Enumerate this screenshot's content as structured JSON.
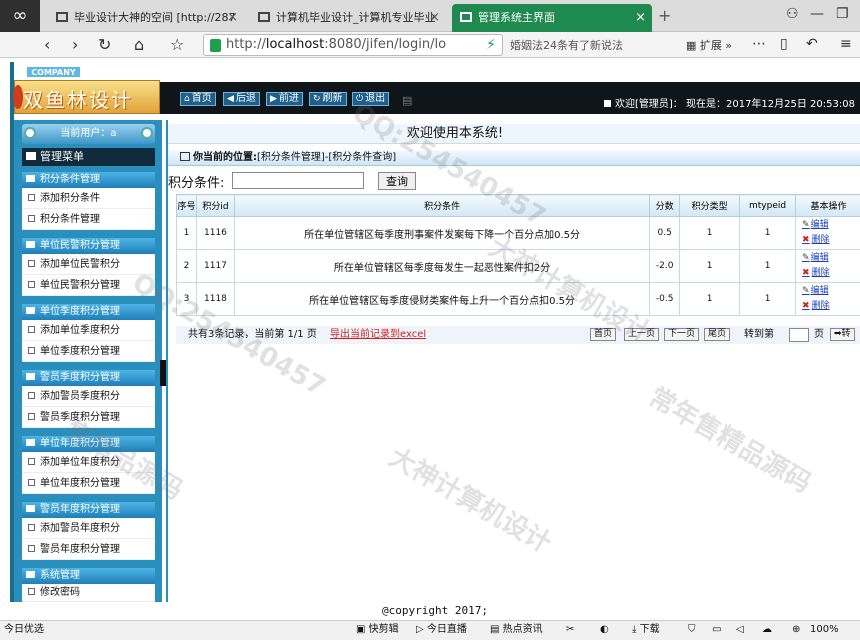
{
  "browser": {
    "tabs": [
      {
        "label": "毕业设计大神的空间 [http://287"
      },
      {
        "label": "计算机毕业设计_计算机专业毕业"
      },
      {
        "label": "管理系统主界面"
      }
    ],
    "url_host": "localhost",
    "url_rest": ":8080/jifen/login/lo",
    "url_prefix": "http://",
    "news": "婚姻法24条有了新说法",
    "ext_label": "扩展",
    "status_left": "今日优选",
    "status_items": [
      "快剪辑",
      "今日直播",
      "热点资讯",
      "下载",
      "100%"
    ]
  },
  "app": {
    "company": "COMPANY",
    "logo_text": "双鱼林设计",
    "topnav": [
      "首页",
      "后退",
      "前进",
      "刷新",
      "退出"
    ],
    "topnav_icons": [
      "home-icon",
      "back-icon",
      "forward-icon",
      "refresh-icon",
      "power-icon"
    ],
    "welcome": "欢迎[管理员]：    现在是：2017年12月25日 20:53:08",
    "footer": "@copyright 2017;"
  },
  "sidebar": {
    "current_user": "当前用户：a",
    "menu_title": "管理菜单",
    "groups": [
      {
        "title": "积分条件管理",
        "items": [
          "添加积分条件",
          "积分条件管理"
        ]
      },
      {
        "title": "单位民警积分管理",
        "items": [
          "添加单位民警积分",
          "单位民警积分管理"
        ]
      },
      {
        "title": "单位季度积分管理",
        "items": [
          "添加单位季度积分",
          "单位季度积分管理"
        ]
      },
      {
        "title": "警员季度积分管理",
        "items": [
          "添加警员季度积分",
          "警员季度积分管理"
        ]
      },
      {
        "title": "单位年度积分管理",
        "items": [
          "添加单位年度积分",
          "单位年度积分管理"
        ]
      },
      {
        "title": "警员年度积分管理",
        "items": [
          "添加警员年度积分",
          "警员年度积分管理"
        ]
      },
      {
        "title": "系统管理",
        "items": [
          "修改密码"
        ]
      }
    ]
  },
  "main": {
    "header": "欢迎使用本系统!",
    "location_label": "你当前的位置:",
    "location_path": "[积分条件管理]-[积分条件查询]",
    "search_label": "积分条件:",
    "search_value": "",
    "search_button": "查询",
    "columns": [
      "序号",
      "积分id",
      "积分条件",
      "分数",
      "积分类型",
      "mtypeid",
      "基本操作"
    ],
    "rows": [
      {
        "no": "1",
        "id": "1116",
        "cond": "所在单位管辖区每季度刑事案件发案每下降一个百分点加0.5分",
        "score": "0.5",
        "type": "1",
        "mtypeid": "1"
      },
      {
        "no": "2",
        "id": "1117",
        "cond": "所在单位管辖区每季度每发生一起恶性案件扣2分",
        "score": "-2.0",
        "type": "1",
        "mtypeid": "1"
      },
      {
        "no": "3",
        "id": "1118",
        "cond": "所在单位管辖区每季度侵财类案件每上升一个百分点扣0.5分",
        "score": "-0.5",
        "type": "1",
        "mtypeid": "1"
      }
    ],
    "op_edit": "编辑",
    "op_delete": "删除",
    "pager_summary": "共有3条记录，当前第 1/1 页",
    "pager_export": "导出当前记录到excel",
    "pager_buttons": [
      "首页",
      "上一页",
      "下一页",
      "尾页"
    ],
    "jump_label": "转到第",
    "jump_unit": "页",
    "jump_button": "转"
  },
  "watermarks": [
    "QQ:254540457",
    "大神计算机设计",
    "常年售精品源码",
    "QQ:254540457",
    "大神计算机设计",
    "售精品源码"
  ]
}
